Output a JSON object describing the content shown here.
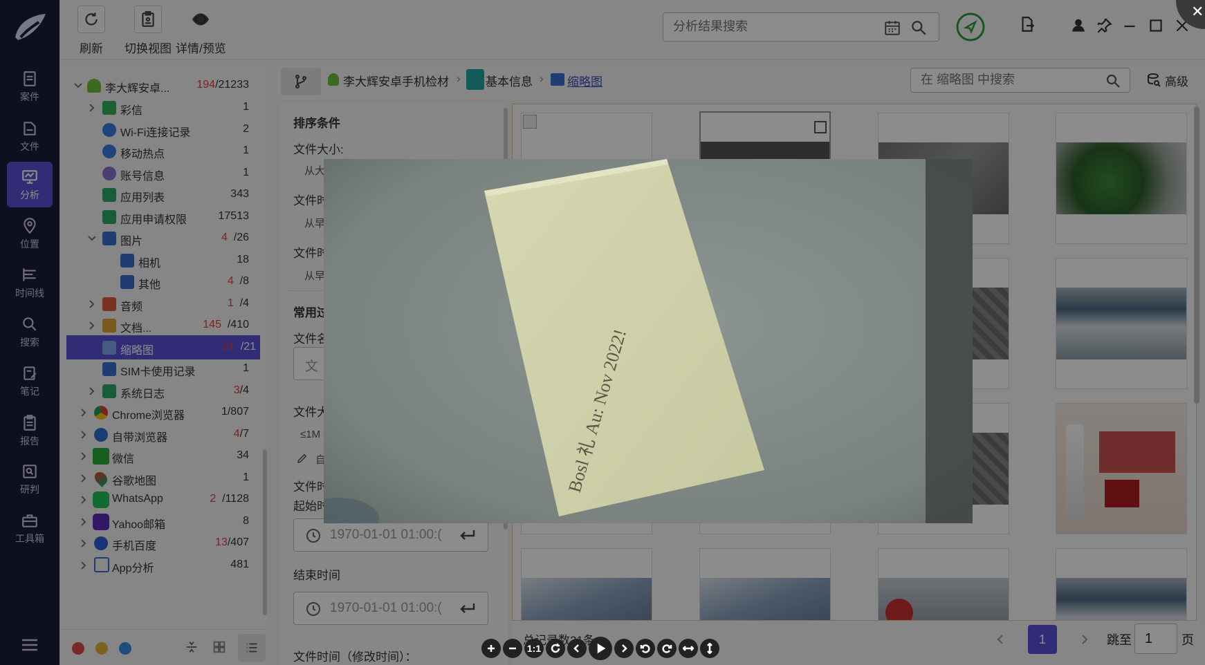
{
  "nav": {
    "items": [
      {
        "label": "案件",
        "icon": "case-icon"
      },
      {
        "label": "文件",
        "icon": "folder-icon"
      },
      {
        "label": "分析",
        "icon": "analysis-icon",
        "active": true
      },
      {
        "label": "位置",
        "icon": "location-icon"
      },
      {
        "label": "时间线",
        "icon": "timeline-icon"
      },
      {
        "label": "搜索",
        "icon": "search-icon"
      },
      {
        "label": "笔记",
        "icon": "note-icon"
      },
      {
        "label": "报告",
        "icon": "report-icon"
      },
      {
        "label": "研判",
        "icon": "judge-icon"
      },
      {
        "label": "工具箱",
        "icon": "toolbox-icon"
      }
    ]
  },
  "toolbar": {
    "refresh_label": "刷新",
    "switch_view_label": "切换视图",
    "detail_label": "详情/预览",
    "search_placeholder": "分析结果搜索"
  },
  "tree": {
    "root": {
      "label": "李大辉安卓...",
      "count_red": "194",
      "count": "/21233"
    },
    "items": [
      {
        "label": "彩信",
        "count_red": "",
        "count": "1"
      },
      {
        "label": "Wi-Fi连接记录",
        "count_red": "",
        "count": "2"
      },
      {
        "label": "移动热点",
        "count_red": "",
        "count": "1"
      },
      {
        "label": "账号信息",
        "count_red": "",
        "count": "1"
      },
      {
        "label": "应用列表",
        "count_red": "",
        "count": "343"
      },
      {
        "label": "应用申请权限",
        "count_red": "",
        "count": "17513"
      },
      {
        "label": "图片",
        "count_red": "4",
        "count": "/26"
      },
      {
        "label": "相机",
        "count_red": "",
        "count": "18"
      },
      {
        "label": "其他",
        "count_red": "4",
        "count": "/8"
      },
      {
        "label": "音频",
        "count_red": "1",
        "count": "/4"
      },
      {
        "label": "文档...",
        "count_red": "145",
        "count": "/410"
      },
      {
        "label": "缩略图",
        "count_red": "21",
        "count": "/21"
      },
      {
        "label": "SIM卡使用记录",
        "count_red": "",
        "count": "1"
      },
      {
        "label": "系统日志",
        "count_red": "3",
        "count": "/4"
      },
      {
        "label": "Chrome浏览器",
        "count_red": "",
        "count": "1/807"
      },
      {
        "label": "自带浏览器",
        "count_red": "4",
        "count": "/7"
      },
      {
        "label": "微信",
        "count_red": "",
        "count": "34"
      },
      {
        "label": "谷歌地图",
        "count_red": "",
        "count": "1"
      },
      {
        "label": "WhatsApp",
        "count_red": "2",
        "count": "/1128"
      },
      {
        "label": "Yahoo邮箱",
        "count_red": "",
        "count": "8"
      },
      {
        "label": "手机百度",
        "count_red": "13",
        "count": "/407"
      },
      {
        "label": "App分析",
        "count_red": "",
        "count": "481"
      }
    ]
  },
  "breadcrumb": {
    "item1": "李大辉安卓手机检材",
    "item2": "基本信息",
    "item3": "缩略图",
    "search_placeholder": "在 缩略图 中搜索",
    "advanced_label": "高级"
  },
  "filters": {
    "sort_title": "排序条件",
    "file_size_label": "文件大小:",
    "from_big": "从大",
    "file_time1": "文件时",
    "from_early1": "从早",
    "file_time2": "文件时",
    "from_early2": "从早",
    "common_title": "常用过",
    "file_name": "文件名",
    "file_name_ph": "文",
    "file_size2": "文件大",
    "size_le": "≤1M",
    "custom": "自",
    "file_time3": "文件时",
    "start_label": "起始时",
    "start_value": "1970-01-01 01:00:(",
    "end_label": "结束时间",
    "end_value": "1970-01-01 01:00:(",
    "modified_label": "文件时间（修改时间）："
  },
  "pager": {
    "total": "总记录数21条",
    "current_page": "1",
    "jump_label": "跳至",
    "jump_value": "1",
    "page_unit": "页"
  },
  "viewer": {
    "actual_size_label": "1:1",
    "photo_text": "Bosl 礼 Au: Nov 2022!"
  },
  "colors": {
    "accent": "#5b4fd6",
    "nav_bg": "#1a1d3d",
    "count_red": "#e0413d"
  }
}
